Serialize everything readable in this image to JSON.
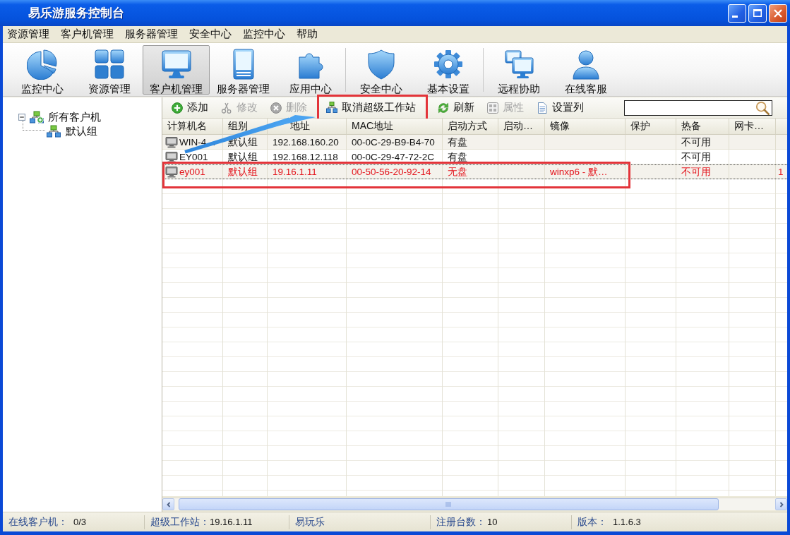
{
  "window": {
    "title": "易乐游服务控制台"
  },
  "menu": [
    "资源管理",
    "客户机管理",
    "服务器管理",
    "安全中心",
    "监控中心",
    "帮助"
  ],
  "toolbar": {
    "groups": [
      [
        {
          "label": "监控中心",
          "selected": false
        },
        {
          "label": "资源管理",
          "selected": false
        },
        {
          "label": "客户机管理",
          "selected": true
        },
        {
          "label": "服务器管理",
          "selected": false
        },
        {
          "label": "应用中心",
          "selected": false
        }
      ],
      [
        {
          "label": "安全中心",
          "selected": false
        },
        {
          "label": "基本设置",
          "selected": false
        }
      ],
      [
        {
          "label": "远程协助",
          "selected": false
        },
        {
          "label": "在线客服",
          "selected": false
        }
      ]
    ]
  },
  "tree": [
    {
      "label": "所有客户机",
      "expanded": true,
      "children": [
        {
          "label": "默认组"
        }
      ]
    }
  ],
  "actions": [
    {
      "label": "添加",
      "disabled": false,
      "highlighted": false
    },
    {
      "label": "修改",
      "disabled": true,
      "highlighted": false
    },
    {
      "label": "删除",
      "disabled": true,
      "highlighted": false
    },
    {
      "label": "取消超级工作站",
      "disabled": false,
      "highlighted": true
    },
    {
      "label": "刷新",
      "disabled": false,
      "highlighted": false
    },
    {
      "label": "属性",
      "disabled": true,
      "highlighted": false
    },
    {
      "label": "设置列",
      "disabled": false,
      "highlighted": false
    }
  ],
  "table": {
    "columns": [
      "计算机名",
      "组别",
      "地址",
      "MAC地址",
      "启动方式",
      "启动…",
      "镜像",
      "保护",
      "热备",
      "网卡…",
      null
    ],
    "rows": [
      {
        "cells": [
          "WIN-4…",
          "默认组",
          "192.168.160.20",
          "00-0C-29-B9-B4-70",
          "有盘",
          null,
          null,
          null,
          "不可用",
          null,
          null
        ],
        "selected": false,
        "super_workstation": false,
        "highlighted": false
      },
      {
        "cells": [
          "EY001",
          "默认组",
          "192.168.12.118",
          "00-0C-29-47-72-2C",
          "有盘",
          null,
          null,
          null,
          "不可用",
          null,
          null
        ],
        "selected": false,
        "super_workstation": false,
        "highlighted": false
      },
      {
        "cells": [
          "ey001",
          "默认组",
          "19.16.1.11",
          "00-50-56-20-92-14",
          "无盘",
          null,
          "winxp6 - 默…",
          null,
          "不可用",
          null,
          "1"
        ],
        "selected": true,
        "super_workstation": true,
        "highlighted": true
      }
    ]
  },
  "annotation_arrow": true,
  "status_bar": [
    {
      "label": "在线客户机：",
      "value": "0/3"
    },
    {
      "label": "超级工作站：",
      "value": "19.16.1.11"
    },
    {
      "label": "易玩乐"
    },
    {
      "label": "注册台数：",
      "value": "10"
    },
    {
      "label": "版本：",
      "value": "1.1.6.3"
    }
  ]
}
